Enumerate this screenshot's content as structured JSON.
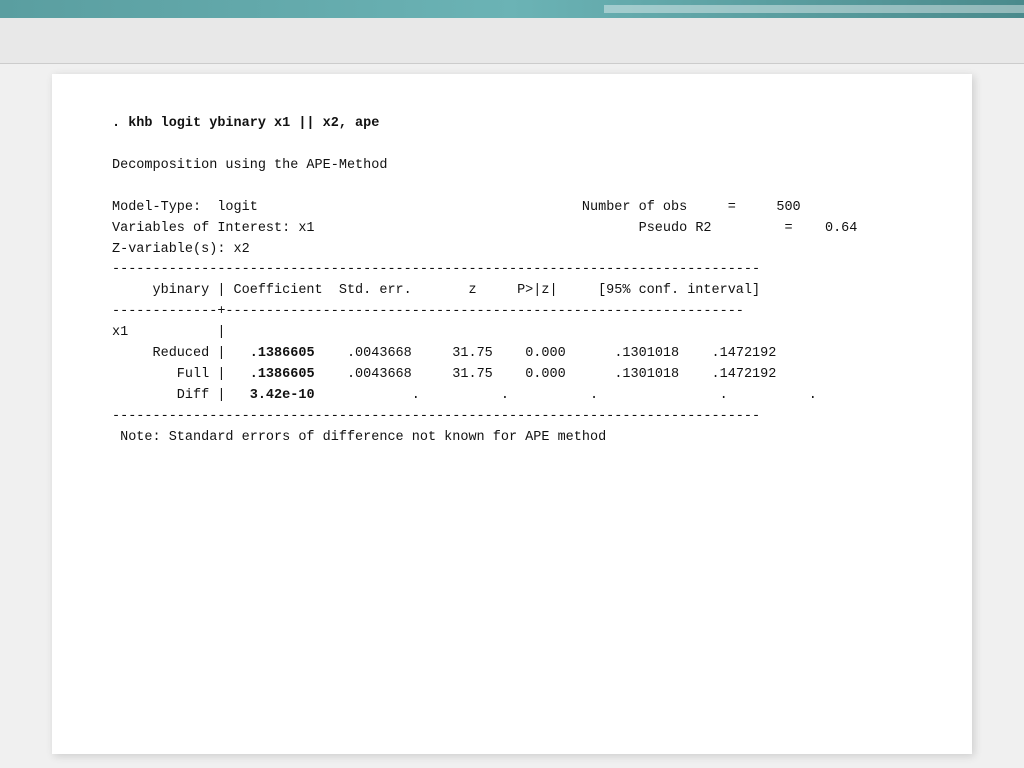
{
  "topbar": {
    "color": "#5a9ea0"
  },
  "content": {
    "command": ". khb logit ybinary x1 || x2, ape",
    "description": "Decomposition using the APE-Method",
    "model_type_label": "Model-Type:  logit",
    "num_obs_label": "Number of obs",
    "num_obs_eq": "=",
    "num_obs_val": "500",
    "pseudo_r2_label": "Pseudo R2",
    "pseudo_r2_eq": "=",
    "pseudo_r2_val": "0.64",
    "variables_label": "Variables of Interest: x1",
    "z_variable_label": "Z-variable(s): x2",
    "col_headers": "     ybinary | Coefficient  Std. err.       z     P>|z|     [95% conf. interval]",
    "separator_top": "-------------+----------------------------------------------------------------",
    "separator_full": "--------------------------------------------------------------------------------",
    "row_x1": "x1           |",
    "row_reduced_label": "     Reduced |",
    "row_reduced_coef": ".1386605",
    "row_reduced_se": ".0043668",
    "row_reduced_z": "31.75",
    "row_reduced_p": "0.000",
    "row_reduced_ci_lo": ".1301018",
    "row_reduced_ci_hi": ".1472192",
    "row_full_label": "        Full |",
    "row_full_coef": ".1386605",
    "row_full_se": ".0043668",
    "row_full_z": "31.75",
    "row_full_p": "0.000",
    "row_full_ci_lo": ".1301018",
    "row_full_ci_hi": ".1472192",
    "row_diff_label": "        Diff |",
    "row_diff_coef": "3.42e-10",
    "row_diff_dots": "        .           .          .               .          .",
    "note": " Note: Standard errors of difference not known for APE method"
  }
}
